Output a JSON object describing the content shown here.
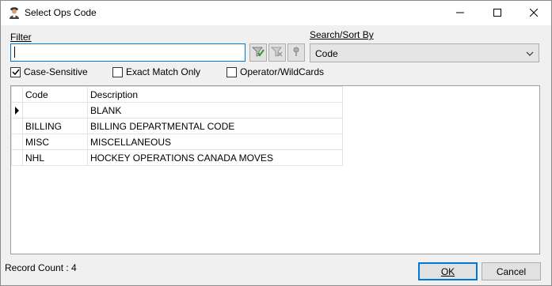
{
  "window": {
    "title": "Select Ops Code",
    "icon": "user-icon",
    "controls": [
      "minimize-icon",
      "maximize-icon",
      "close-icon"
    ]
  },
  "filter": {
    "label": "Filter",
    "value": "",
    "tools": [
      "apply-filter-icon",
      "clear-filter-icon",
      "pin-icon"
    ]
  },
  "search_sort": {
    "label": "Search/Sort By",
    "selected": "Code"
  },
  "options": {
    "case_sensitive": {
      "label": "Case-Sensitive",
      "checked": true
    },
    "exact_match": {
      "label": "Exact Match Only",
      "checked": false
    },
    "wildcards": {
      "label": "Operator/WildCards",
      "checked": false
    }
  },
  "grid": {
    "columns": [
      "Code",
      "Description"
    ],
    "rows": [
      {
        "code": "",
        "description": "BLANK",
        "current": true
      },
      {
        "code": "BILLING",
        "description": "BILLING DEPARTMENTAL CODE",
        "current": false
      },
      {
        "code": "MISC",
        "description": "MISCELLANEOUS",
        "current": false
      },
      {
        "code": "NHL",
        "description": "HOCKEY OPERATIONS CANADA MOVES",
        "current": false
      }
    ]
  },
  "footer": {
    "record_count": "Record Count : 4",
    "ok_label": "OK",
    "cancel_label": "Cancel"
  },
  "colors": {
    "accent": "#0078d7",
    "window_bg": "#f0f0f0",
    "button_bg": "#e1e1e1"
  }
}
